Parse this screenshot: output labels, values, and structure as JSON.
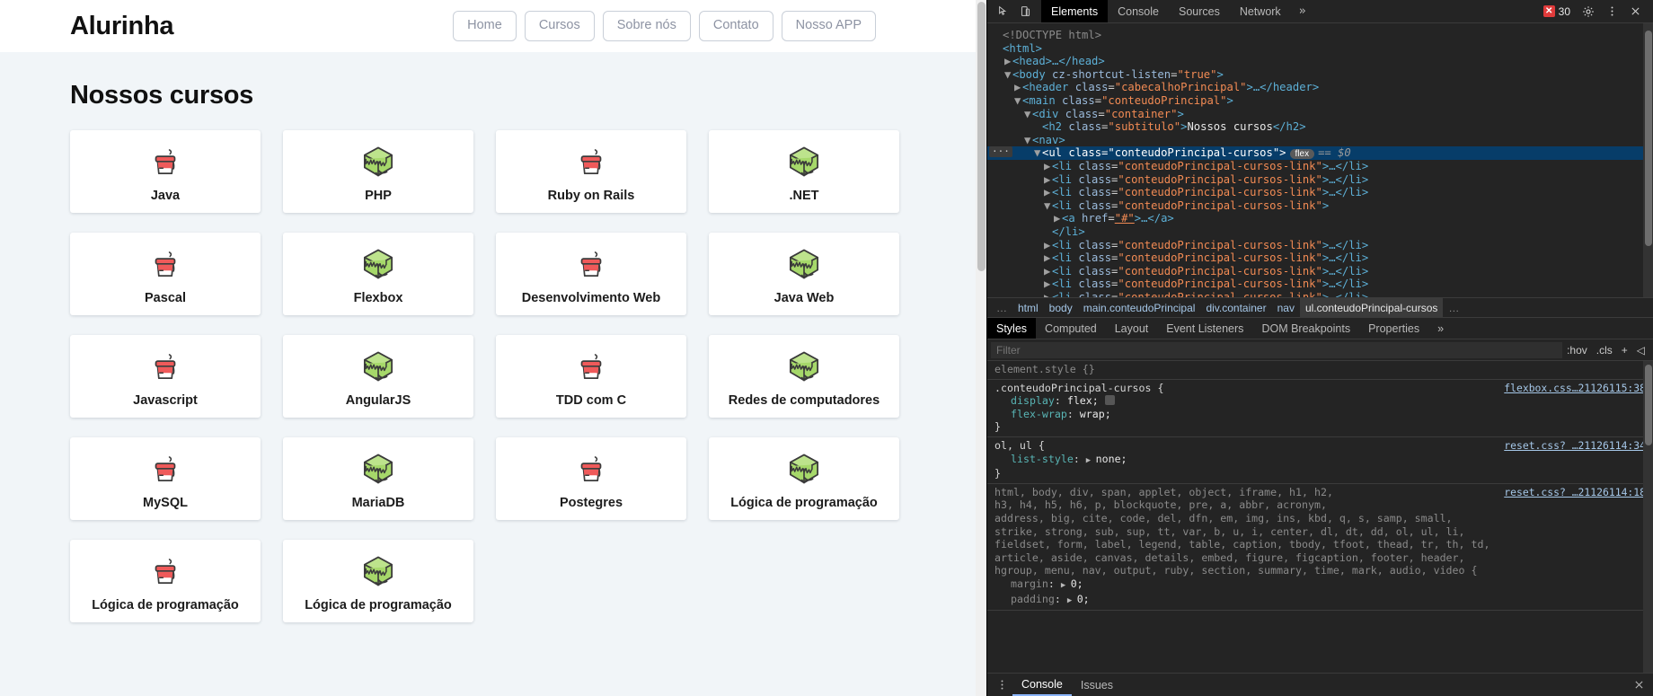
{
  "site": {
    "brand": "Alurinha",
    "nav": [
      {
        "label": "Home"
      },
      {
        "label": "Cursos"
      },
      {
        "label": "Sobre nós"
      },
      {
        "label": "Contato"
      },
      {
        "label": "Nosso APP"
      }
    ],
    "subtitulo": "Nossos cursos",
    "cursos": [
      {
        "nome": "Java",
        "icon": "coffee-cup-icon"
      },
      {
        "nome": "PHP",
        "icon": "green-cube-icon"
      },
      {
        "nome": "Ruby on Rails",
        "icon": "coffee-cup-icon"
      },
      {
        "nome": ".NET",
        "icon": "green-cube-icon"
      },
      {
        "nome": "Pascal",
        "icon": "coffee-cup-icon"
      },
      {
        "nome": "Flexbox",
        "icon": "green-cube-icon"
      },
      {
        "nome": "Desenvolvimento Web",
        "icon": "coffee-cup-icon"
      },
      {
        "nome": "Java Web",
        "icon": "green-cube-icon"
      },
      {
        "nome": "Javascript",
        "icon": "coffee-cup-icon"
      },
      {
        "nome": "AngularJS",
        "icon": "green-cube-icon"
      },
      {
        "nome": "TDD com C",
        "icon": "coffee-cup-icon"
      },
      {
        "nome": "Redes de computadores",
        "icon": "green-cube-icon"
      },
      {
        "nome": "MySQL",
        "icon": "coffee-cup-icon"
      },
      {
        "nome": "MariaDB",
        "icon": "green-cube-icon"
      },
      {
        "nome": "Postegres",
        "icon": "coffee-cup-icon"
      },
      {
        "nome": "Lógica de programação",
        "icon": "green-cube-icon"
      },
      {
        "nome": "Lógica de programação",
        "icon": "coffee-cup-icon"
      },
      {
        "nome": "Lógica de programação",
        "icon": "green-cube-icon"
      }
    ]
  },
  "devtools": {
    "tabs": [
      {
        "label": "Elements",
        "active": true
      },
      {
        "label": "Console",
        "active": false
      },
      {
        "label": "Sources",
        "active": false
      },
      {
        "label": "Network",
        "active": false
      }
    ],
    "more_tabs": "»",
    "error_count": "30",
    "error_glyph": "✕",
    "icons": {
      "inspect": "inspect-element-icon",
      "device": "device-toolbar-icon",
      "settings": "gear-icon",
      "kebab": "more-options-icon",
      "close": "close-icon"
    },
    "dom": [
      {
        "indent": 0,
        "tri": "",
        "content": "doctype"
      },
      {
        "indent": 0,
        "tri": "",
        "content": "html-open"
      },
      {
        "indent": 1,
        "tri": "▶",
        "content": "head"
      },
      {
        "indent": 1,
        "tri": "▼",
        "content": "body"
      },
      {
        "indent": 2,
        "tri": "▶",
        "content": "header"
      },
      {
        "indent": 2,
        "tri": "▼",
        "content": "main"
      },
      {
        "indent": 3,
        "tri": "▼",
        "content": "container"
      },
      {
        "indent": 4,
        "tri": "",
        "content": "h2"
      },
      {
        "indent": 3,
        "tri": "▼",
        "content": "nav"
      },
      {
        "indent": 4,
        "tri": "▼",
        "content": "ul",
        "selected": true
      },
      {
        "indent": 5,
        "tri": "▶",
        "content": "li"
      },
      {
        "indent": 5,
        "tri": "▶",
        "content": "li"
      },
      {
        "indent": 5,
        "tri": "▶",
        "content": "li"
      },
      {
        "indent": 5,
        "tri": "▼",
        "content": "li-open"
      },
      {
        "indent": 6,
        "tri": "▶",
        "content": "a"
      },
      {
        "indent": 5,
        "tri": "",
        "content": "li-close"
      },
      {
        "indent": 5,
        "tri": "▶",
        "content": "li"
      },
      {
        "indent": 5,
        "tri": "▶",
        "content": "li"
      },
      {
        "indent": 5,
        "tri": "▶",
        "content": "li"
      },
      {
        "indent": 5,
        "tri": "▶",
        "content": "li"
      },
      {
        "indent": 5,
        "tri": "▶",
        "content": "li"
      },
      {
        "indent": 5,
        "tri": "▶",
        "content": "li"
      }
    ],
    "dom_text": {
      "doctype": "<!DOCTYPE html>",
      "html_tag": "<html>",
      "head_collapsed": "<head>…</head>",
      "body_tag": "<body",
      "body_attr": "cz-shortcut-listen",
      "body_val": "\"true\"",
      "header_tag": "<header",
      "class_attr": "class",
      "header_val": "\"cabecalhoPrincipal\"",
      "header_rest": ">…</header>",
      "main_tag": "<main",
      "main_val": "\"conteudoPrincipal\"",
      "div_tag": "<div",
      "div_val": "\"container\"",
      "h2_tag": "<h2",
      "h2_val": "\"subtitulo\"",
      "h2_text": "Nossos cursos",
      "h2_close": "</h2>",
      "nav_tag": "<nav>",
      "ul_tag": "<ul",
      "ul_val": "\"conteudoPrincipal-cursos\"",
      "ul_badge": "flex",
      "ul_eq": "== $0",
      "li_tag": "<li",
      "li_val": "\"conteudoPrincipal-cursos-link\"",
      "li_collapsed": ">…</li>",
      "li_open": ">",
      "li_close": "</li>",
      "a_tag": "<a",
      "a_href_attr": "href",
      "a_href_val": "\"#\"",
      "a_rest": ">…</a>",
      "ellipsis": "···"
    },
    "breadcrumb": [
      {
        "label": "…",
        "active": false
      },
      {
        "label": "html",
        "active": false
      },
      {
        "label": "body",
        "active": false
      },
      {
        "label": "main.conteudoPrincipal",
        "active": false
      },
      {
        "label": "div.container",
        "active": false
      },
      {
        "label": "nav",
        "active": false
      },
      {
        "label": "ul.conteudoPrincipal-cursos",
        "active": true
      },
      {
        "label": "…",
        "active": false
      }
    ],
    "styles_tabs": [
      {
        "label": "Styles",
        "active": true
      },
      {
        "label": "Computed",
        "active": false
      },
      {
        "label": "Layout",
        "active": false
      },
      {
        "label": "Event Listeners",
        "active": false
      },
      {
        "label": "DOM Breakpoints",
        "active": false
      },
      {
        "label": "Properties",
        "active": false
      }
    ],
    "styles_more": "»",
    "filter": {
      "placeholder": "Filter",
      "value": ""
    },
    "filter_opts": [
      ":hov",
      ".cls",
      "+",
      "◁"
    ],
    "css_rules": [
      {
        "selector": "element.style {",
        "origin": "",
        "declarations": [],
        "close": "}",
        "dim": true
      },
      {
        "selector": ".conteudoPrincipal-cursos {",
        "origin": "flexbox.css…21126115:38",
        "declarations": [
          {
            "prop": "display",
            "value": "flex;",
            "swatch": true
          },
          {
            "prop": "flex-wrap",
            "value": "wrap;",
            "swatch": false
          }
        ],
        "close": "}",
        "dim": false
      },
      {
        "selector": "ol, ul {",
        "origin": "reset.css? …21126114:34",
        "declarations": [
          {
            "prop": "list-style",
            "value": "none;",
            "expand": true
          }
        ],
        "close": "}",
        "dim": false
      },
      {
        "selector": "html, body, div, span, applet, object, iframe, h1, h2,\nh3, h4, h5, h6, p, blockquote, pre, a, abbr, acronym,\naddress, big, cite, code, del, dfn, em, img, ins, kbd, q, s, samp, small,\nstrike, strong, sub, sup, tt, var, b, u, i, center, dl, dt, dd, ol, ul, li,\nfieldset, form, label, legend, table, caption, tbody, tfoot, thead, tr, th, td,\narticle, aside, canvas, details, embed, figure, figcaption, footer, header,\nhgroup, menu, nav, output, ruby, section, summary, time, mark, audio, video {",
        "origin": "reset.css? …21126114:18",
        "declarations": [
          {
            "prop": "margin",
            "value": "0;",
            "expand": true
          },
          {
            "prop": "padding",
            "value": "0;",
            "expand": true
          }
        ],
        "close": "",
        "dim": true
      }
    ],
    "drawer_tabs": [
      {
        "label": "Console",
        "active": true
      },
      {
        "label": "Issues",
        "active": false
      }
    ],
    "drawer_close": "✕",
    "drawer_kebab": "⋮"
  },
  "colors": {
    "devtools_bg": "#242424",
    "selected_row": "#073d69",
    "accent_link": "#a5c7e8",
    "error_red": "#e03b3b",
    "page_bg": "#f1f5f8",
    "cube_green": "#a6d86a",
    "cup_red": "#ed5a5a"
  }
}
